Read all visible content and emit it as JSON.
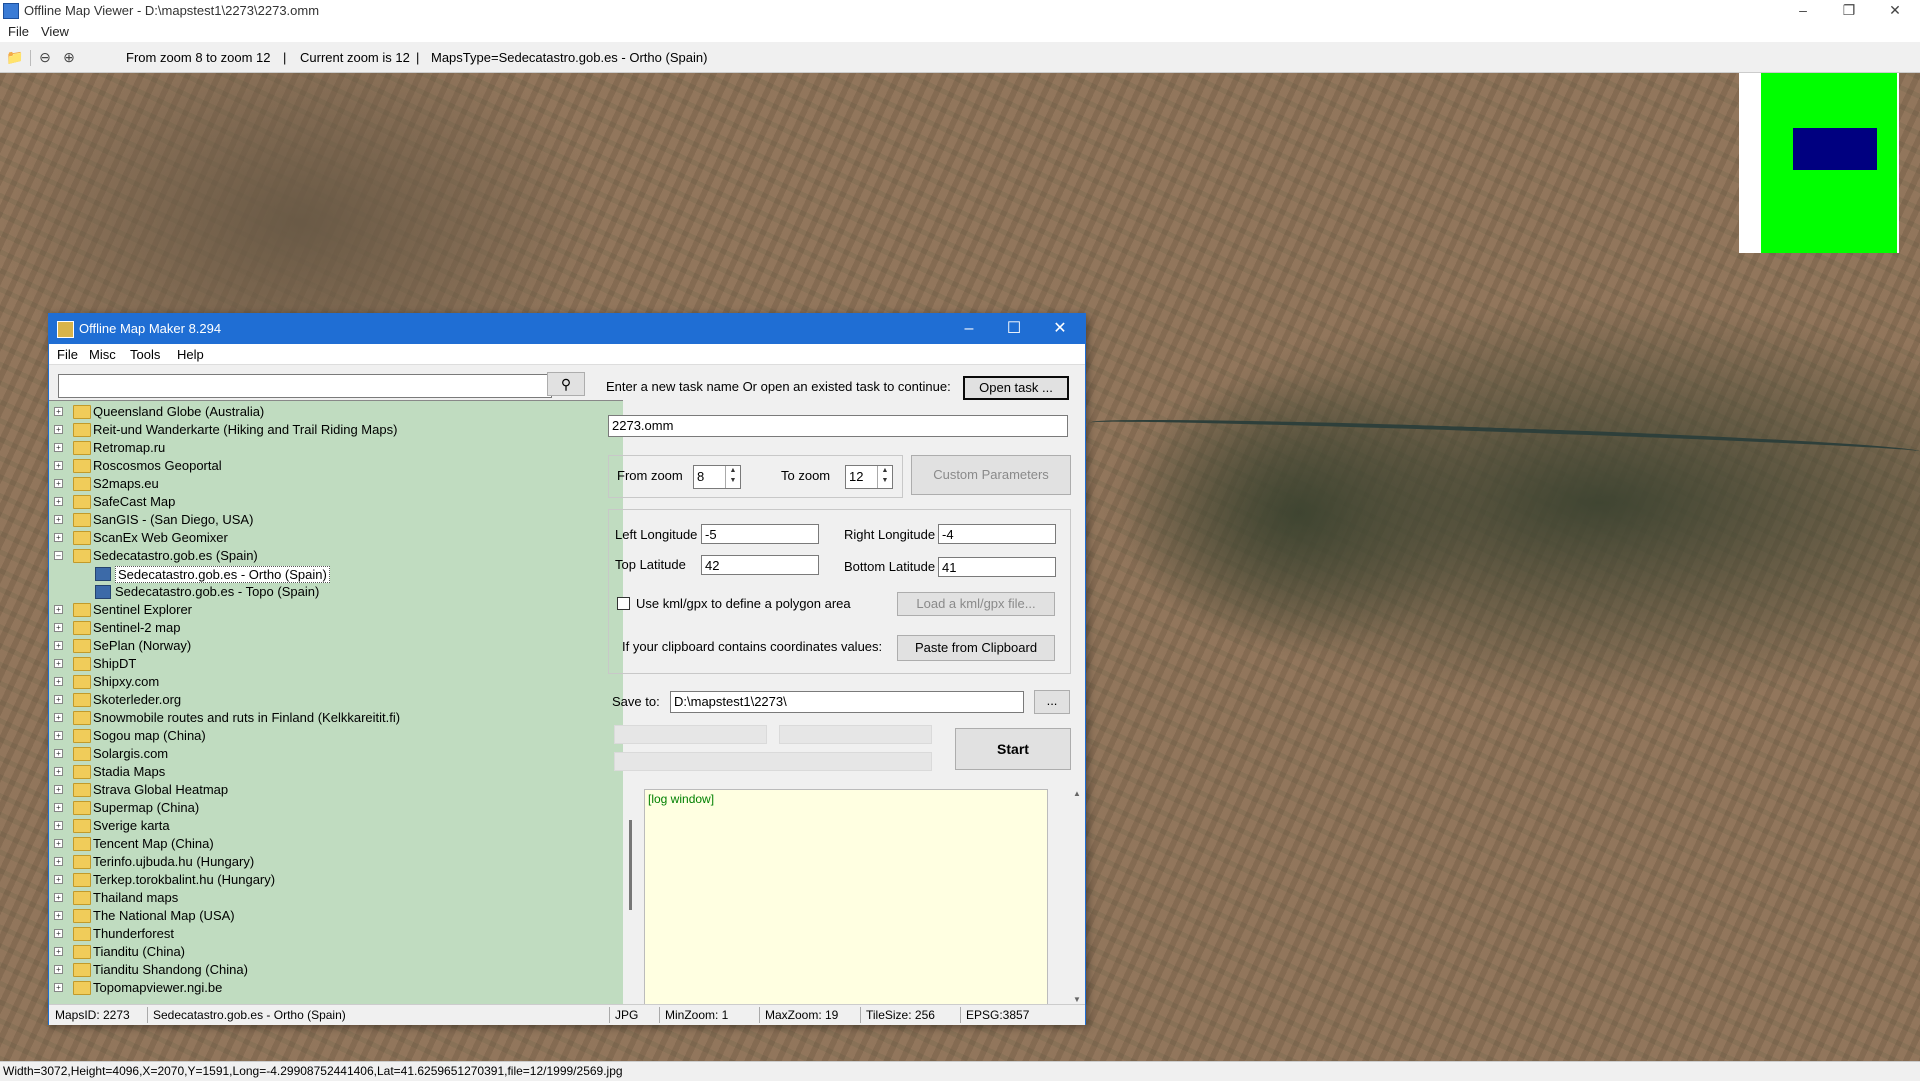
{
  "viewer": {
    "title": "Offline Map Viewer - D:\\mapstest1\\2273\\2273.omm",
    "menu": [
      "File",
      "View"
    ],
    "toolbar_info": {
      "zoom_range": "From zoom 8 to zoom 12",
      "current_zoom": "Current zoom is 12",
      "maps_type": "MapsType=Sedecatastro.gob.es - Ortho (Spain)"
    },
    "status": "Width=3072,Height=4096,X=2070,Y=1591,Long=-4.29908752441406,Lat=41.6259651270391,file=12/1999/2569.jpg"
  },
  "dialog": {
    "title": "Offline Map Maker 8.294",
    "menu": [
      "File",
      "Misc",
      "Tools",
      "Help"
    ],
    "search_placeholder": "",
    "tree": [
      {
        "label": "Queensland Globe (Australia)"
      },
      {
        "label": "Reit-und Wanderkarte (Hiking and Trail Riding Maps)"
      },
      {
        "label": "Retromap.ru"
      },
      {
        "label": "Roscosmos Geoportal"
      },
      {
        "label": "S2maps.eu"
      },
      {
        "label": "SafeCast Map"
      },
      {
        "label": "SanGIS - (San Diego, USA)"
      },
      {
        "label": "ScanEx Web Geomixer"
      },
      {
        "label": "Sedecatastro.gob.es (Spain)"
      },
      {
        "label": "Sedecatastro.gob.es - Ortho (Spain)"
      },
      {
        "label": "Sedecatastro.gob.es - Topo (Spain)"
      },
      {
        "label": "Sentinel Explorer"
      },
      {
        "label": "Sentinel-2 map"
      },
      {
        "label": "SePlan (Norway)"
      },
      {
        "label": "ShipDT"
      },
      {
        "label": "Shipxy.com"
      },
      {
        "label": "Skoterleder.org"
      },
      {
        "label": "Snowmobile routes and ruts in Finland (Kelkkareitit.fi)"
      },
      {
        "label": "Sogou map (China)"
      },
      {
        "label": "Solargis.com"
      },
      {
        "label": "Stadia Maps"
      },
      {
        "label": "Strava Global Heatmap"
      },
      {
        "label": "Supermap (China)"
      },
      {
        "label": "Sverige karta"
      },
      {
        "label": "Tencent Map (China)"
      },
      {
        "label": "Terinfo.ujbuda.hu (Hungary)"
      },
      {
        "label": "Terkep.torokbalint.hu (Hungary)"
      },
      {
        "label": "Thailand maps"
      },
      {
        "label": "The National Map (USA)"
      },
      {
        "label": "Thunderforest"
      },
      {
        "label": "Tianditu (China)"
      },
      {
        "label": "Tianditu Shandong (China)"
      },
      {
        "label": "Topomapviewer.ngi.be"
      }
    ],
    "task_prompt": "Enter a new task name Or open an existed task to continue:",
    "open_task_label": "Open task ...",
    "task_name": "2273.omm",
    "from_zoom_label": "From zoom",
    "from_zoom": "8",
    "to_zoom_label": "To zoom",
    "to_zoom": "12",
    "custom_params_label": "Custom Parameters",
    "left_lon_label": "Left Longitude",
    "left_lon": "-5",
    "right_lon_label": "Right Longitude",
    "right_lon": "-4",
    "top_lat_label": "Top Latitude",
    "top_lat": "42",
    "bottom_lat_label": "Bottom Latitude",
    "bottom_lat": "41",
    "kml_label": "Use kml/gpx to define a polygon area",
    "load_kml_label": "Load a kml/gpx file...",
    "clipboard_prompt": "If your clipboard contains coordinates values:",
    "paste_label": "Paste from Clipboard",
    "save_to_label": "Save to:",
    "save_to": "D:\\mapstest1\\2273\\",
    "browse_label": "...",
    "start_label": "Start",
    "log_text": "[log window]",
    "status": {
      "maps_id": "MapsID: 2273",
      "maps_name": "Sedecatastro.gob.es - Ortho (Spain)",
      "format": "JPG",
      "min_zoom": "MinZoom: 1",
      "max_zoom": "MaxZoom: 19",
      "tile_size": "TileSize: 256",
      "epsg": "EPSG:3857"
    }
  }
}
